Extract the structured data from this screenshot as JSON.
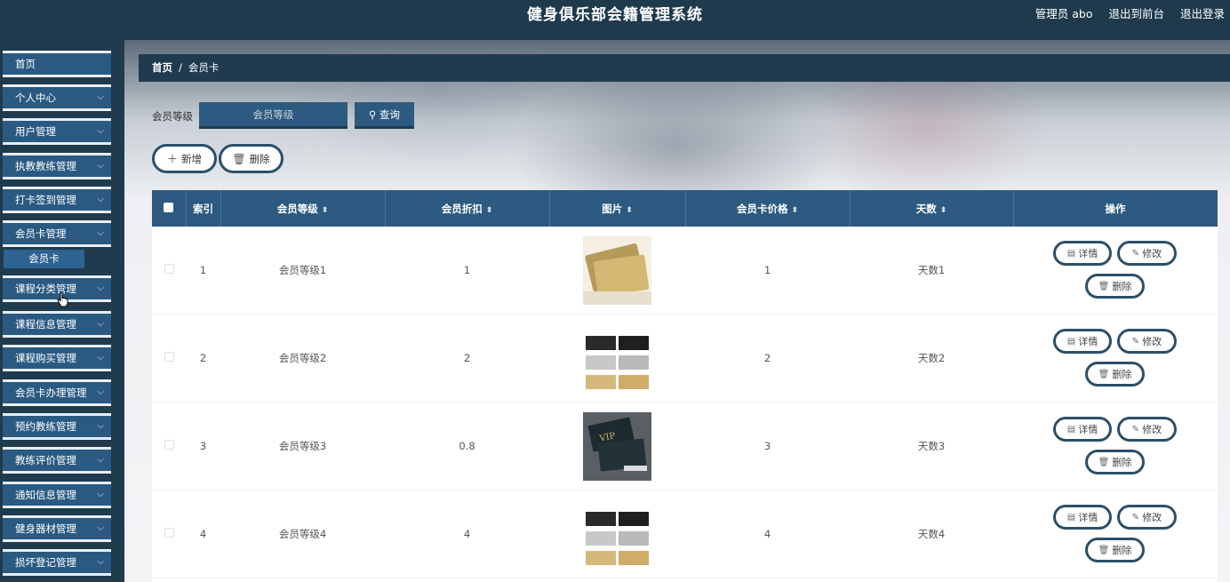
{
  "header": {
    "title": "健身俱乐部会籍管理系统",
    "admin": "管理员 abo",
    "front": "退出到前台",
    "logout": "退出登录"
  },
  "sidebar": {
    "items": [
      {
        "label": "首页",
        "chevron": false
      },
      {
        "label": "个人中心",
        "chevron": true
      },
      {
        "label": "用户管理",
        "chevron": true
      },
      {
        "label": "执教教练管理",
        "chevron": true
      },
      {
        "label": "打卡签到管理",
        "chevron": true
      },
      {
        "label": "会员卡管理",
        "chevron": true
      },
      {
        "label": "课程分类管理",
        "chevron": true
      },
      {
        "label": "课程信息管理",
        "chevron": true
      },
      {
        "label": "课程购买管理",
        "chevron": true
      },
      {
        "label": "会员卡办理管理",
        "chevron": true
      },
      {
        "label": "预约教练管理",
        "chevron": true
      },
      {
        "label": "教练评价管理",
        "chevron": true
      },
      {
        "label": "通知信息管理",
        "chevron": true
      },
      {
        "label": "健身器材管理",
        "chevron": true
      },
      {
        "label": "损坏登记管理",
        "chevron": true
      }
    ],
    "active_sub": "会员卡"
  },
  "breadcrumb": {
    "home": "首页",
    "sep": "/",
    "current": "会员卡"
  },
  "search": {
    "label": "会员等级",
    "placeholder": "会员等级",
    "query_label": "查询"
  },
  "actions": {
    "add": "新增",
    "delete": "删除"
  },
  "table": {
    "headers": [
      "索引",
      "会员等级",
      "会员折扣",
      "图片",
      "会员卡价格",
      "天数",
      "操作"
    ],
    "rows": [
      {
        "index": "1",
        "level": "会员等级1",
        "discount": "1",
        "price": "1",
        "days": "天数1",
        "img": "gold"
      },
      {
        "index": "2",
        "level": "会员等级2",
        "discount": "2",
        "price": "2",
        "days": "天数2",
        "img": "grid"
      },
      {
        "index": "3",
        "level": "会员等级3",
        "discount": "0.8",
        "price": "3",
        "days": "天数3",
        "img": "vip"
      },
      {
        "index": "4",
        "level": "会员等级4",
        "discount": "4",
        "price": "4",
        "days": "天数4",
        "img": "grid"
      }
    ],
    "op_labels": {
      "detail": "详情",
      "edit": "修改",
      "delete": "删除"
    }
  },
  "colors": {
    "primary": "#2c5a80",
    "dark": "#1f3b4d"
  }
}
